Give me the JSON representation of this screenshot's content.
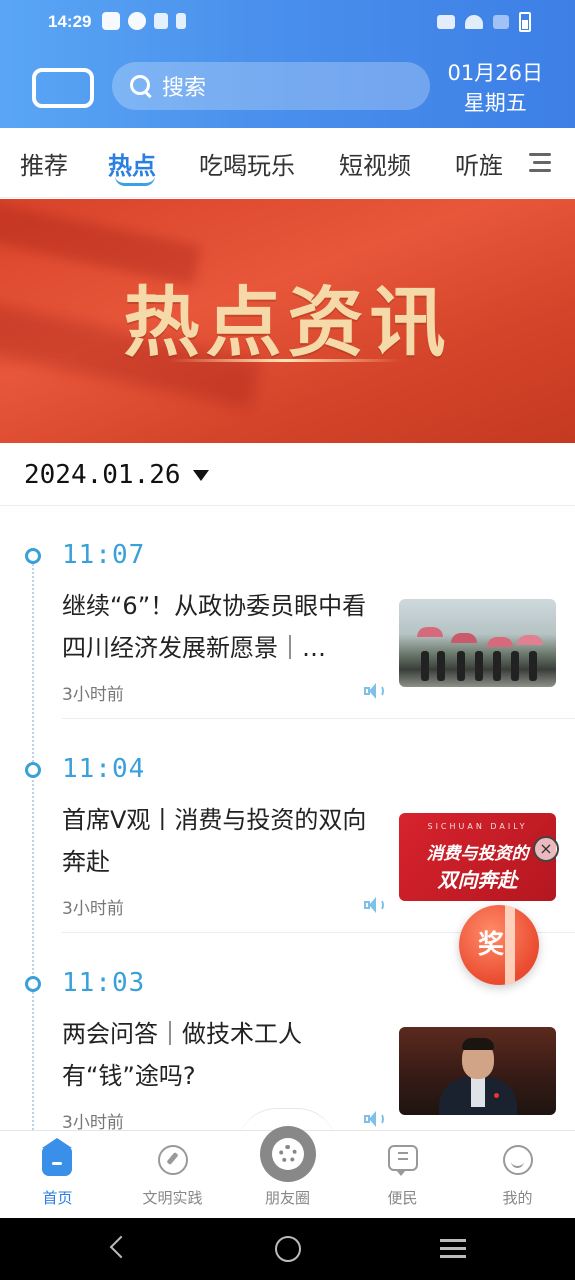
{
  "status_bar": {
    "time": "14:29"
  },
  "header": {
    "search_placeholder": "搜索",
    "date": "01月26日",
    "weekday": "星期五"
  },
  "tabs": [
    {
      "label": "推荐",
      "active": false
    },
    {
      "label": "热点",
      "active": true
    },
    {
      "label": "吃喝玩乐",
      "active": false
    },
    {
      "label": "短视频",
      "active": false
    },
    {
      "label": "听旌",
      "active": false
    }
  ],
  "banner": {
    "title": "热点资讯"
  },
  "date_selector": {
    "value": "2024.01.26"
  },
  "news": [
    {
      "time": "11:07",
      "title": "继续“6”！从政协委员眼中看四川经济发展新愿景｜…",
      "meta": "3小时前"
    },
    {
      "time": "11:04",
      "title": "首席V观丨消费与投资的双向奔赴",
      "meta": "3小时前",
      "thumb_text_top": "SICHUAN DAILY",
      "thumb_text_a": "消费与投资的",
      "thumb_text_b": "双向奔赴"
    },
    {
      "time": "11:03",
      "title": "两会问答｜做技术工人有“钱”途吗?",
      "meta": "3小时前"
    }
  ],
  "floating": {
    "close": "×",
    "reward_label": "奖"
  },
  "bottom_nav": [
    {
      "label": "首页",
      "icon": "home-icon",
      "active": true
    },
    {
      "label": "文明实践",
      "icon": "compass-icon",
      "active": false
    },
    {
      "label": "朋友圈",
      "icon": "camera-icon",
      "active": false
    },
    {
      "label": "便民",
      "icon": "chat-icon",
      "active": false
    },
    {
      "label": "我的",
      "icon": "smile-icon",
      "active": false
    }
  ],
  "colors": {
    "accent": "#2a7fe0",
    "timeline": "#3aa0d8",
    "banner": "#d8432a",
    "banner_text": "#f6d9a8"
  }
}
